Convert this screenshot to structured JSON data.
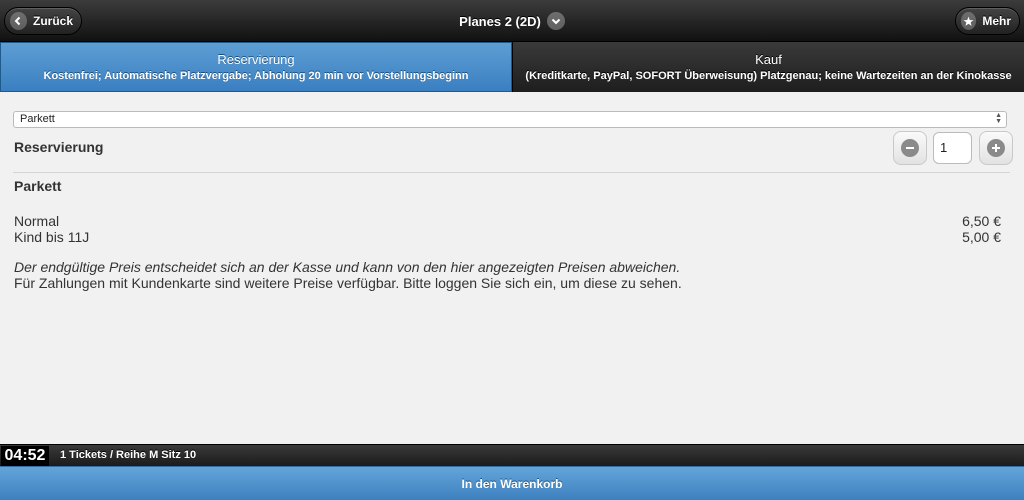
{
  "header": {
    "back_label": "Zurück",
    "title": "Planes 2 (2D)",
    "more_label": "Mehr"
  },
  "tabs": [
    {
      "title": "Reservierung",
      "description": "Kostenfrei; Automatische Platzvergabe; Abholung 20 min vor Vorstellungsbeginn",
      "active": true
    },
    {
      "title": "Kauf",
      "description": "(Kreditkarte, PayPal, SOFORT Überweisung) Platzgenau; keine Wartezeiten an der Kinokasse",
      "active": false
    }
  ],
  "select": {
    "value": "Parkett"
  },
  "reservation": {
    "label": "Reservierung",
    "quantity": "1"
  },
  "section": {
    "title": "Parkett"
  },
  "prices": [
    {
      "label": "Normal",
      "price": "6,50 €"
    },
    {
      "label": "Kind bis 11J",
      "price": "5,00 €"
    }
  ],
  "notes": {
    "italic": "Der endgültige Preis entscheidet sich an der Kasse und kann von den hier angezeigten Preisen abweichen.",
    "plain": "Für Zahlungen mit Kundenkarte sind weitere Preise verfügbar. Bitte loggen Sie sich ein, um diese zu sehen."
  },
  "footer": {
    "timer": "04:52",
    "tickets": "1 Tickets / Reihe M Sitz 10",
    "cart_label": "In den Warenkorb"
  },
  "colors": {
    "accent": "#4a90cc",
    "header_bg": "#1f1f1f",
    "page_bg": "#f1f1f1"
  },
  "icons": {
    "back": "chevron-left-icon",
    "title_dropdown": "chevron-down-icon",
    "more": "star-icon",
    "minus": "minus-icon",
    "plus": "plus-icon"
  }
}
